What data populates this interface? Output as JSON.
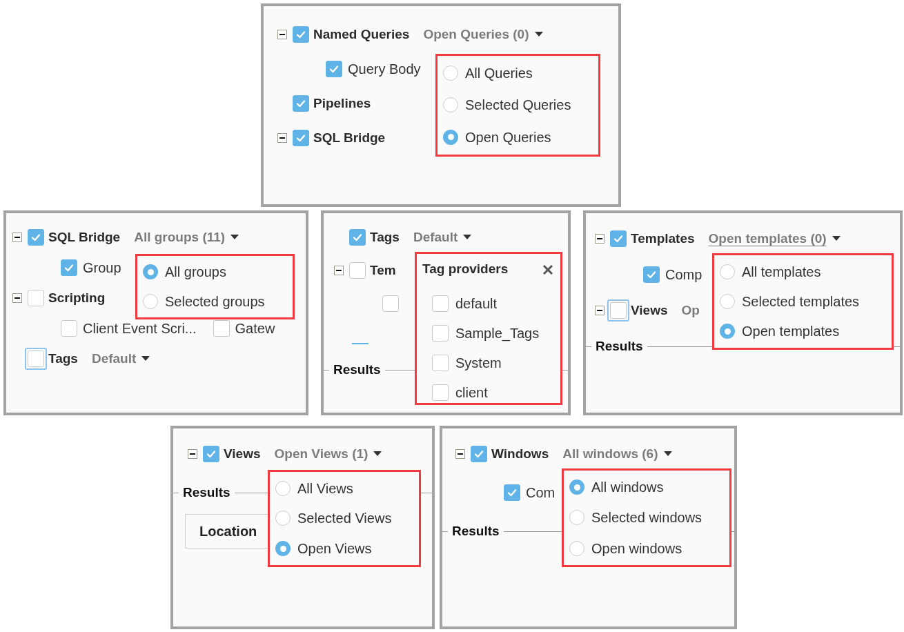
{
  "panels": [
    {
      "tree": [
        {
          "kind": "node",
          "label": "Named Queries",
          "expanded": true,
          "checked": true,
          "focused": false,
          "dropdown": {
            "text": "Open Queries (0)",
            "underlined": false,
            "caret": true
          },
          "children": [
            {
              "label": "Query Body",
              "checked": true
            }
          ]
        },
        {
          "kind": "node",
          "label": "Pipelines",
          "checked": true,
          "focused": false
        },
        {
          "kind": "node",
          "label": "SQL Bridge",
          "expanded": true,
          "checked": true,
          "focused": false
        }
      ],
      "popup": {
        "kind": "radio",
        "options": [
          {
            "label": "All Queries",
            "selected": false
          },
          {
            "label": "Selected Queries",
            "selected": false
          },
          {
            "label": "Open Queries",
            "selected": true
          }
        ]
      }
    },
    {
      "tree": [
        {
          "kind": "node",
          "label": "SQL Bridge",
          "expanded": true,
          "checked": true,
          "focused": false,
          "dropdown": {
            "text": "All groups (11)",
            "underlined": false,
            "caret": true
          },
          "children": [
            {
              "label": "Group",
              "checked": true
            }
          ]
        },
        {
          "kind": "node",
          "label": "Scripting",
          "expanded": true,
          "checked": false,
          "focused": false,
          "children": [
            {
              "label": "Client Event Scri...",
              "checked": false
            },
            {
              "label": "Gatew",
              "checked": false
            }
          ]
        },
        {
          "kind": "node",
          "label": "Tags",
          "checked": false,
          "focused": true,
          "dropdown": {
            "text": "Default",
            "underlined": false,
            "caret": true
          }
        }
      ],
      "popup": {
        "kind": "radio",
        "options": [
          {
            "label": "All groups",
            "selected": true
          },
          {
            "label": "Selected groups",
            "selected": false
          }
        ]
      }
    },
    {
      "tree": [
        {
          "kind": "node",
          "label": "Tags",
          "checked": true,
          "focused": false,
          "dropdown": {
            "text": "Default",
            "underlined": false,
            "caret": true
          }
        },
        {
          "kind": "node",
          "label": "Tem",
          "expanded": true,
          "checked": false,
          "focused": false,
          "children": [
            {
              "checked": false
            }
          ]
        },
        {
          "kind": "marker"
        },
        {
          "kind": "section",
          "label": "Results"
        }
      ],
      "popup": {
        "kind": "checklist",
        "title": "Tag providers",
        "items": [
          {
            "label": "default",
            "checked": false
          },
          {
            "label": "Sample_Tags",
            "checked": false
          },
          {
            "label": "System",
            "checked": false
          },
          {
            "label": "client",
            "checked": false
          }
        ]
      }
    },
    {
      "tree": [
        {
          "kind": "node",
          "label": "Templates",
          "expanded": true,
          "checked": true,
          "focused": false,
          "dropdown": {
            "text": "Open templates (0)",
            "underlined": true,
            "caret": true
          },
          "children": [
            {
              "label": "Comp",
              "checked": true
            }
          ]
        },
        {
          "kind": "node",
          "label": "Views",
          "expanded": true,
          "checked": false,
          "focused": true,
          "dropdown": {
            "text": "Op",
            "underlined": false,
            "caret": false
          }
        },
        {
          "kind": "section",
          "label": "Results"
        }
      ],
      "popup": {
        "kind": "radio",
        "options": [
          {
            "label": "All templates",
            "selected": false
          },
          {
            "label": "Selected templates",
            "selected": false
          },
          {
            "label": "Open templates",
            "selected": true
          }
        ]
      }
    },
    {
      "tree": [
        {
          "kind": "node",
          "label": "Views",
          "expanded": true,
          "checked": true,
          "focused": false,
          "dropdown": {
            "text": "Open Views (1)",
            "underlined": false,
            "caret": true
          }
        },
        {
          "kind": "section",
          "label": "Results"
        },
        {
          "kind": "column_header",
          "label": "Location"
        }
      ],
      "popup": {
        "kind": "radio",
        "options": [
          {
            "label": "All Views",
            "selected": false
          },
          {
            "label": "Selected Views",
            "selected": false
          },
          {
            "label": "Open Views",
            "selected": true
          }
        ]
      }
    },
    {
      "tree": [
        {
          "kind": "node",
          "label": "Windows",
          "expanded": true,
          "checked": true,
          "focused": false,
          "dropdown": {
            "text": "All windows (6)",
            "underlined": false,
            "caret": true
          },
          "children": [
            {
              "label": "Com",
              "checked": true
            }
          ]
        },
        {
          "kind": "section",
          "label": "Results"
        }
      ],
      "popup": {
        "kind": "radio",
        "options": [
          {
            "label": "All windows",
            "selected": true
          },
          {
            "label": "Selected windows",
            "selected": false
          },
          {
            "label": "Open windows",
            "selected": false
          }
        ]
      }
    }
  ]
}
